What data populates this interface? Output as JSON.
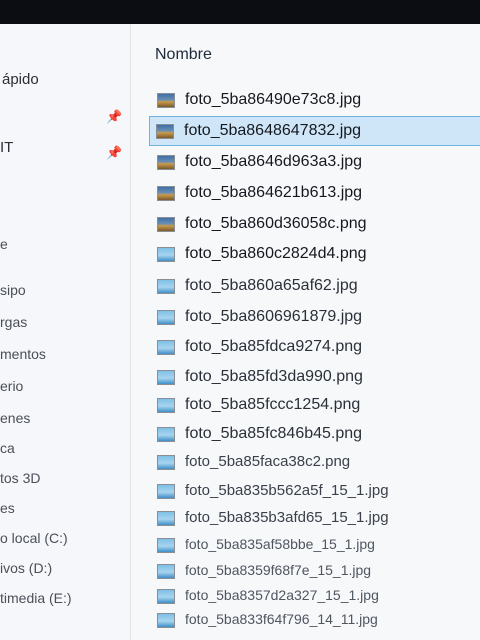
{
  "nav": {
    "items": [
      {
        "label": "ápido",
        "pinned": false
      },
      {
        "label": "",
        "pinned": true
      },
      {
        "label": "IT",
        "pinned": true
      },
      {
        "label": "e",
        "pinned": false
      },
      {
        "label": "sipo",
        "pinned": false
      },
      {
        "label": "rgas",
        "pinned": false
      },
      {
        "label": "mentos",
        "pinned": false
      },
      {
        "label": "erio",
        "pinned": false
      },
      {
        "label": "enes",
        "pinned": false
      },
      {
        "label": "ca",
        "pinned": false
      },
      {
        "label": "tos 3D",
        "pinned": false
      },
      {
        "label": "es",
        "pinned": false
      },
      {
        "label": "o local (C:)",
        "pinned": false
      },
      {
        "label": "ivos (D:)",
        "pinned": false
      },
      {
        "label": "timedia (E:)",
        "pinned": false
      }
    ]
  },
  "list": {
    "column_header": "Nombre",
    "files": [
      {
        "name": "foto_5ba86490e73c8.jpg",
        "type": "jpg"
      },
      {
        "name": "foto_5ba8648647832.jpg",
        "type": "jpg",
        "selected": true
      },
      {
        "name": "foto_5ba8646d963a3.jpg",
        "type": "jpg"
      },
      {
        "name": "foto_5ba864621b613.jpg",
        "type": "jpg"
      },
      {
        "name": "foto_5ba860d36058c.png",
        "type": "png"
      },
      {
        "name": "foto_5ba860c2824d4.png",
        "type": "png"
      },
      {
        "name": "foto_5ba860a65af62.jpg",
        "type": "png"
      },
      {
        "name": "foto_5ba8606961879.jpg",
        "type": "png"
      },
      {
        "name": "foto_5ba85fdca9274.png",
        "type": "png"
      },
      {
        "name": "foto_5ba85fd3da990.png",
        "type": "png"
      },
      {
        "name": "foto_5ba85fccc1254.png",
        "type": "png"
      },
      {
        "name": "foto_5ba85fc846b45.png",
        "type": "png"
      },
      {
        "name": "foto_5ba85faca38c2.png",
        "type": "png"
      },
      {
        "name": "foto_5ba835b562a5f_15_1.jpg",
        "type": "png"
      },
      {
        "name": "foto_5ba835b3afd65_15_1.jpg",
        "type": "png"
      },
      {
        "name": "foto_5ba835af58bbe_15_1.jpg",
        "type": "png"
      },
      {
        "name": "foto_5ba8359f68f7e_15_1.jpg",
        "type": "png"
      },
      {
        "name": "foto_5ba8357d2a327_15_1.jpg",
        "type": "png"
      },
      {
        "name": "foto_5ba833f64f796_14_11.jpg",
        "type": "png"
      }
    ]
  }
}
